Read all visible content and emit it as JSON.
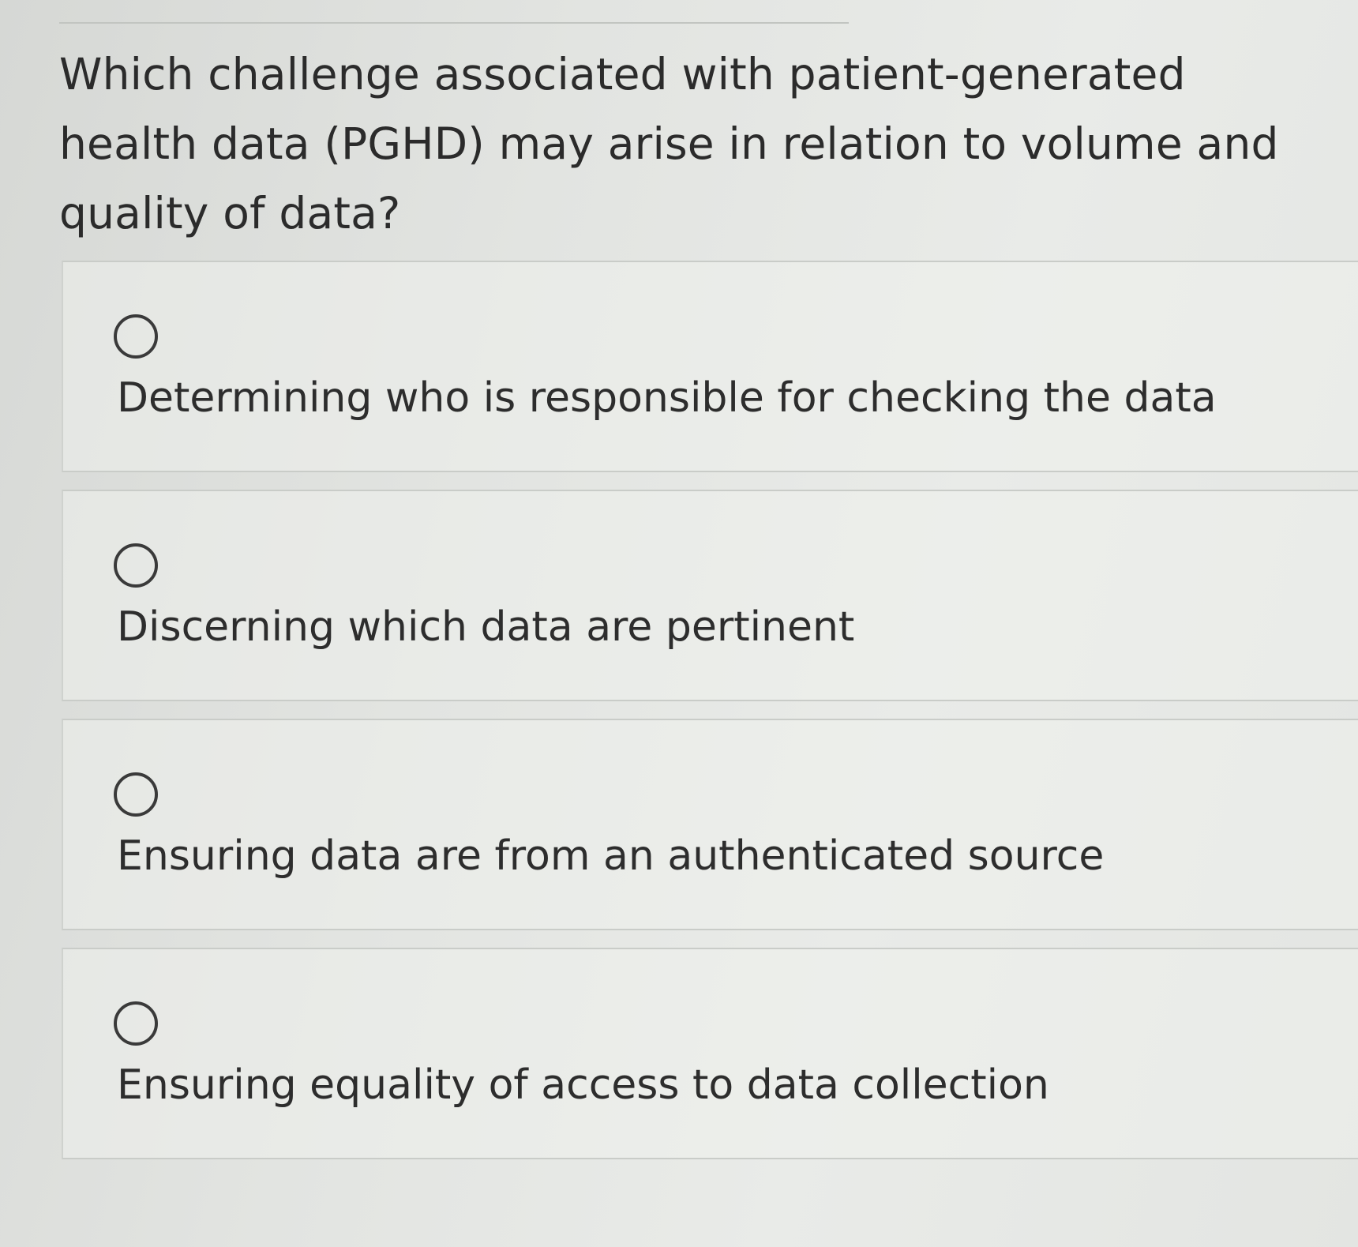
{
  "question": {
    "text": "Which challenge associated with patient-generated health data (PGHD) may arise in relation to volume and quality of data?"
  },
  "options": [
    {
      "label": "Determining who is responsible for checking the data",
      "selected": false
    },
    {
      "label": "Discerning which data are pertinent",
      "selected": false
    },
    {
      "label": "Ensuring data are from an authenticated source",
      "selected": false
    },
    {
      "label": "Ensuring equality of access to data collection",
      "selected": false
    }
  ]
}
